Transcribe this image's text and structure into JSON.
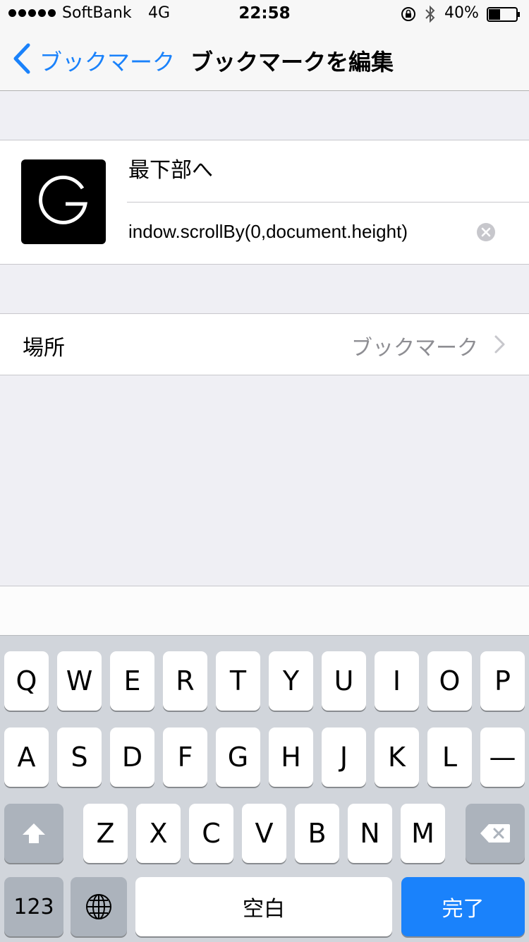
{
  "status_bar": {
    "carrier": "SoftBank",
    "network": "4G",
    "time": "22:58",
    "battery_percent": "40%",
    "icons": [
      "orientation-lock-icon",
      "bluetooth-icon",
      "battery-icon"
    ]
  },
  "nav": {
    "back_label": "ブックマーク",
    "title": "ブックマークを編集"
  },
  "bookmark": {
    "favicon_letter": "G",
    "title_value": "最下部へ",
    "url_value": "indow.scrollBy(0,document.height)"
  },
  "location": {
    "label": "場所",
    "value": "ブックマーク"
  },
  "keyboard": {
    "row1": [
      "Q",
      "W",
      "E",
      "R",
      "T",
      "Y",
      "U",
      "I",
      "O",
      "P"
    ],
    "row2": [
      "A",
      "S",
      "D",
      "F",
      "G",
      "H",
      "J",
      "K",
      "L",
      "—"
    ],
    "row3": [
      "Z",
      "X",
      "C",
      "V",
      "B",
      "N",
      "M"
    ],
    "numbers_label": "123",
    "space_label": "空白",
    "done_label": "完了"
  },
  "colors": {
    "accent": "#1a82fb",
    "background": "#efeff4",
    "keyboard": "#d1d5db",
    "secondary_text": "#8e8e93"
  }
}
